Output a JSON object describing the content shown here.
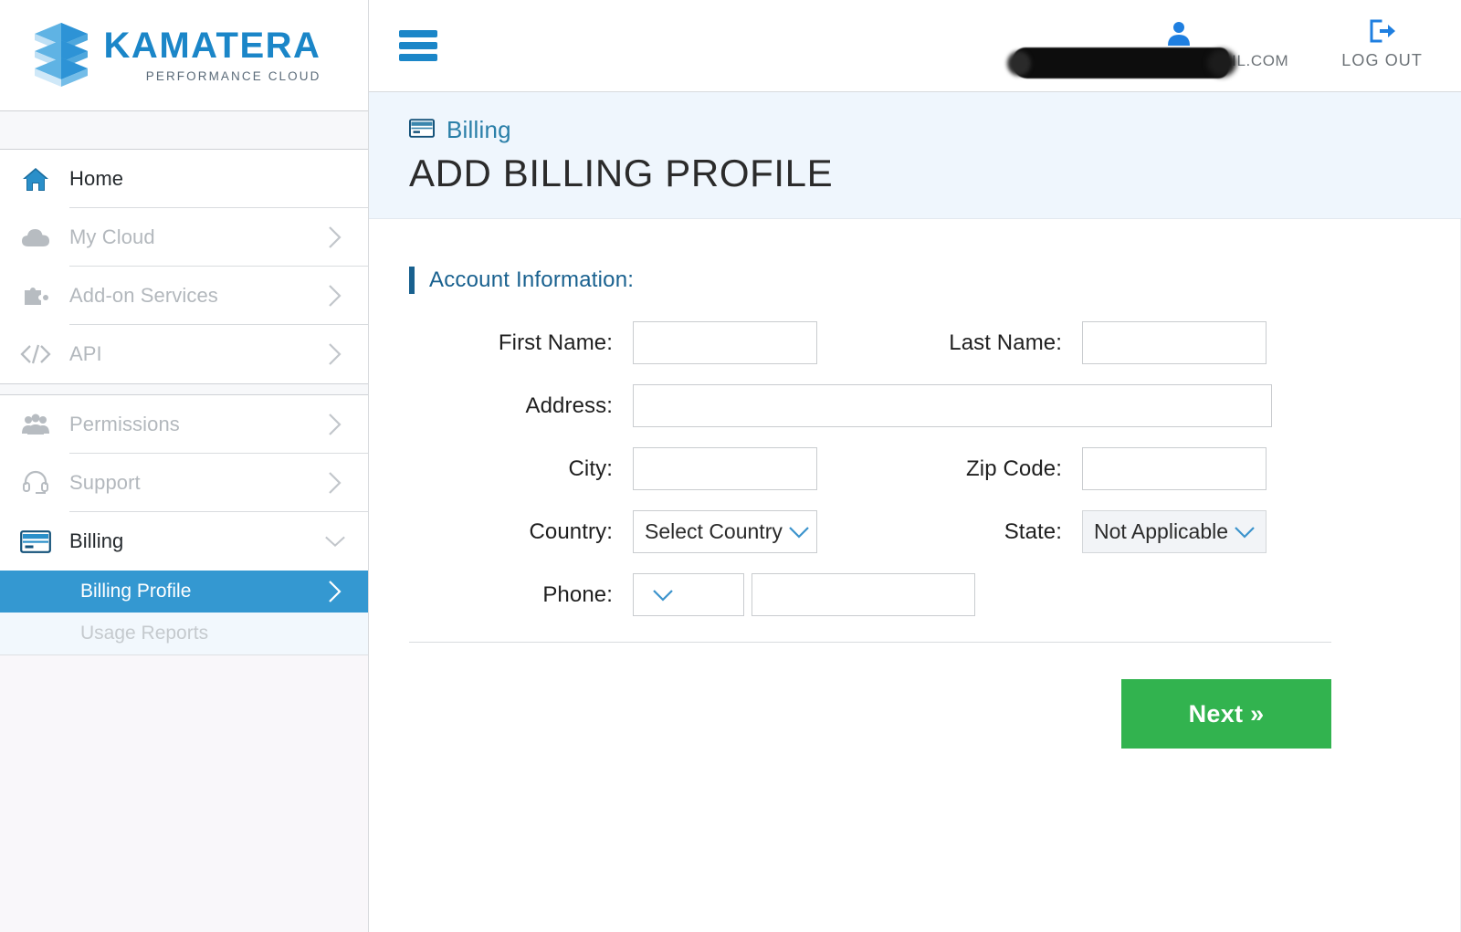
{
  "brand": {
    "name": "KAMATERA",
    "tagline": "PERFORMANCE CLOUD",
    "logo_blue": "#1b86c8",
    "accent_blue": "#3498d1",
    "section_blue": "#19618f",
    "next_green": "#32b34f"
  },
  "topbar": {
    "menu_icon": "hamburger-icon",
    "user_icon": "user-icon",
    "user_email": "PARIKSHA227@GMAIL.COM",
    "logout_label": "LOG OUT",
    "logout_icon": "logout-arrow-icon"
  },
  "sidebar": {
    "groups": [
      {
        "items": [
          {
            "label": "Home",
            "icon": "home-icon",
            "dim": false,
            "arrow": false
          },
          {
            "label": "My Cloud",
            "icon": "cloud-icon",
            "dim": true,
            "arrow": true
          },
          {
            "label": "Add-on Services",
            "icon": "puzzle-icon",
            "dim": true,
            "arrow": true
          },
          {
            "label": "API",
            "icon": "code-icon",
            "dim": true,
            "arrow": true
          }
        ]
      },
      {
        "items": [
          {
            "label": "Permissions",
            "icon": "users-icon",
            "dim": true,
            "arrow": true
          },
          {
            "label": "Support",
            "icon": "headset-icon",
            "dim": true,
            "arrow": true
          },
          {
            "label": "Billing",
            "icon": "credit-card-icon",
            "dim": false,
            "arrow": false,
            "expanded": true
          }
        ]
      }
    ],
    "subitems": [
      {
        "label": "Billing Profile",
        "state": "active"
      },
      {
        "label": "Usage Reports",
        "state": "muted"
      }
    ]
  },
  "page": {
    "breadcrumb": "Billing",
    "breadcrumb_icon": "credit-card-icon",
    "title": "ADD BILLING PROFILE"
  },
  "form": {
    "section_title": "Account Information:",
    "rows": [
      {
        "left": {
          "label": "First Name:",
          "type": "text",
          "value": "",
          "placeholder": ""
        },
        "right": {
          "label": "Last Name:",
          "type": "text",
          "value": "",
          "placeholder": ""
        }
      },
      {
        "left": {
          "label": "Address:",
          "type": "text-wide",
          "value": "",
          "placeholder": ""
        }
      },
      {
        "left": {
          "label": "City:",
          "type": "text",
          "value": "",
          "placeholder": ""
        },
        "right": {
          "label": "Zip Code:",
          "type": "text",
          "value": "",
          "placeholder": ""
        }
      },
      {
        "left": {
          "label": "Country:",
          "type": "select",
          "value": "Select Country",
          "disabled": false
        },
        "right": {
          "label": "State:",
          "type": "select",
          "value": "Not Applicable",
          "disabled": true
        }
      },
      {
        "left": {
          "label": "Phone:",
          "type": "phone",
          "code_value": "",
          "number_value": ""
        }
      }
    ],
    "labels": {
      "first_name": "First Name:",
      "last_name": "Last Name:",
      "address": "Address:",
      "city": "City:",
      "zip_code": "Zip Code:",
      "country": "Country:",
      "state": "State:",
      "phone": "Phone:"
    },
    "values": {
      "first_name": "",
      "last_name": "",
      "address": "",
      "city": "",
      "zip_code": "",
      "country": "Select Country",
      "state": "Not Applicable",
      "phone_code": "",
      "phone_number": ""
    }
  },
  "actions": {
    "next_label": "Next »"
  }
}
